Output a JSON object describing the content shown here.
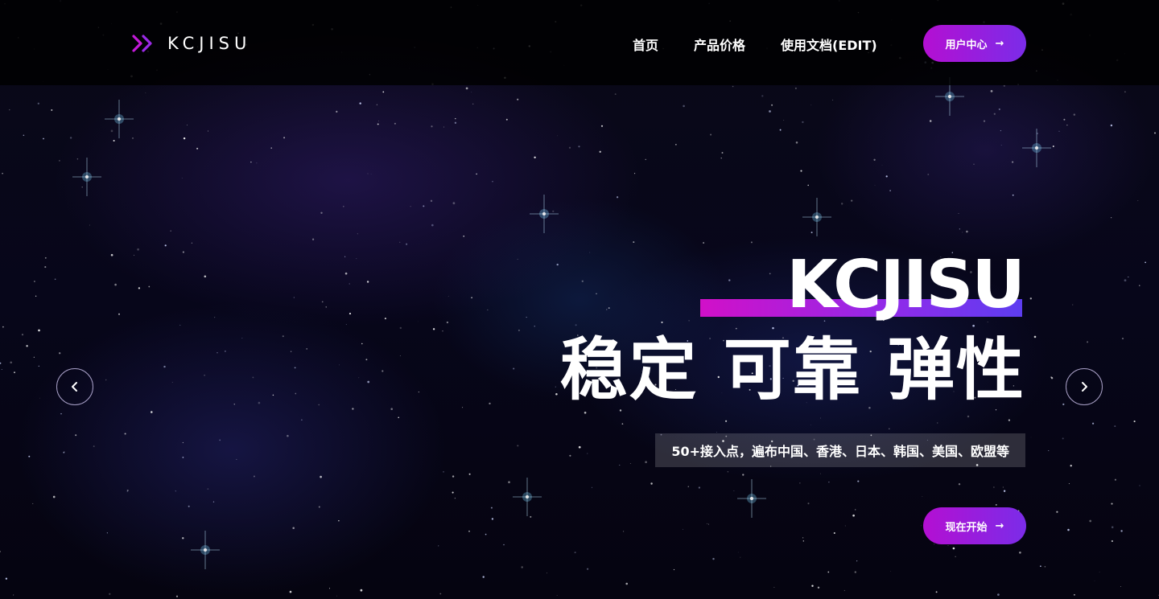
{
  "brand": {
    "name": "KCJISU",
    "accent_start": "#b40fd2",
    "accent_end": "#7b2ce8",
    "logo_icon": "double-chevron-right-icon"
  },
  "nav": {
    "items": [
      {
        "label": "首页"
      },
      {
        "label": "产品价格"
      },
      {
        "label": "使用文档(EDIT)"
      }
    ],
    "user_center": "用户中心",
    "user_center_icon": "arrow-right-icon"
  },
  "hero": {
    "title": "KCJISU",
    "subtitle": "稳定 可靠 弹性",
    "note": "50+接入点，遍布中国、香港、日本、韩国、美国、欧盟等",
    "cta": "现在开始",
    "cta_icon": "arrow-right-icon",
    "prev_icon": "chevron-left-icon",
    "next_icon": "chevron-right-icon"
  }
}
